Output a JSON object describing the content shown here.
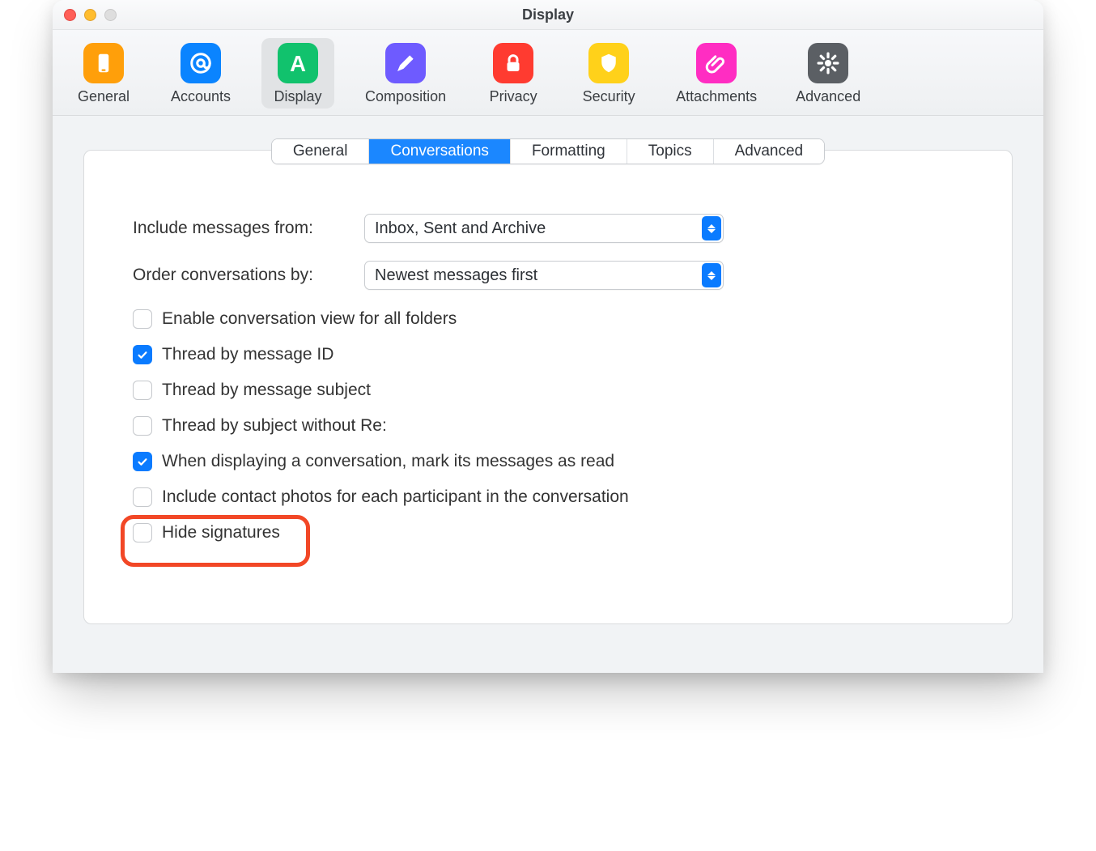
{
  "window": {
    "title": "Display"
  },
  "toolbar": {
    "items": [
      {
        "id": "general",
        "label": "General",
        "icon": "phone-icon",
        "bg": "#ff9f0a"
      },
      {
        "id": "accounts",
        "label": "Accounts",
        "icon": "at-icon",
        "bg": "#0a84ff"
      },
      {
        "id": "display",
        "label": "Display",
        "icon": "letter-a-icon",
        "bg": "#11c26d",
        "selected": true
      },
      {
        "id": "composition",
        "label": "Composition",
        "icon": "pencil-icon",
        "bg": "#6e5bff"
      },
      {
        "id": "privacy",
        "label": "Privacy",
        "icon": "lock-icon",
        "bg": "#ff3b30"
      },
      {
        "id": "security",
        "label": "Security",
        "icon": "shield-icon",
        "bg": "#ffd11a"
      },
      {
        "id": "attachments",
        "label": "Attachments",
        "icon": "clip-icon",
        "bg": "#ff2dc2"
      },
      {
        "id": "advanced",
        "label": "Advanced",
        "icon": "gear-icon",
        "bg": "#5b5f64"
      }
    ]
  },
  "tabs": {
    "items": [
      {
        "id": "general",
        "label": "General"
      },
      {
        "id": "conversations",
        "label": "Conversations",
        "active": true
      },
      {
        "id": "formatting",
        "label": "Formatting"
      },
      {
        "id": "topics",
        "label": "Topics"
      },
      {
        "id": "advanced",
        "label": "Advanced"
      }
    ]
  },
  "form": {
    "includeLabel": "Include messages from:",
    "includeValue": "Inbox, Sent and Archive",
    "orderLabel": "Order conversations by:",
    "orderValue": "Newest messages first",
    "checkboxes": [
      {
        "id": "enable-all",
        "label": "Enable conversation view for all folders",
        "checked": false
      },
      {
        "id": "thread-id",
        "label": "Thread by message ID",
        "checked": true
      },
      {
        "id": "thread-subject",
        "label": "Thread by message subject",
        "checked": false
      },
      {
        "id": "thread-no-re",
        "label": "Thread by subject without Re:",
        "checked": false
      },
      {
        "id": "mark-read",
        "label": "When displaying a conversation, mark its messages as read",
        "checked": true
      },
      {
        "id": "contact-photos",
        "label": "Include contact photos for each participant in the conversation",
        "checked": false
      },
      {
        "id": "hide-signatures",
        "label": "Hide signatures",
        "checked": false,
        "highlighted": true
      }
    ]
  }
}
